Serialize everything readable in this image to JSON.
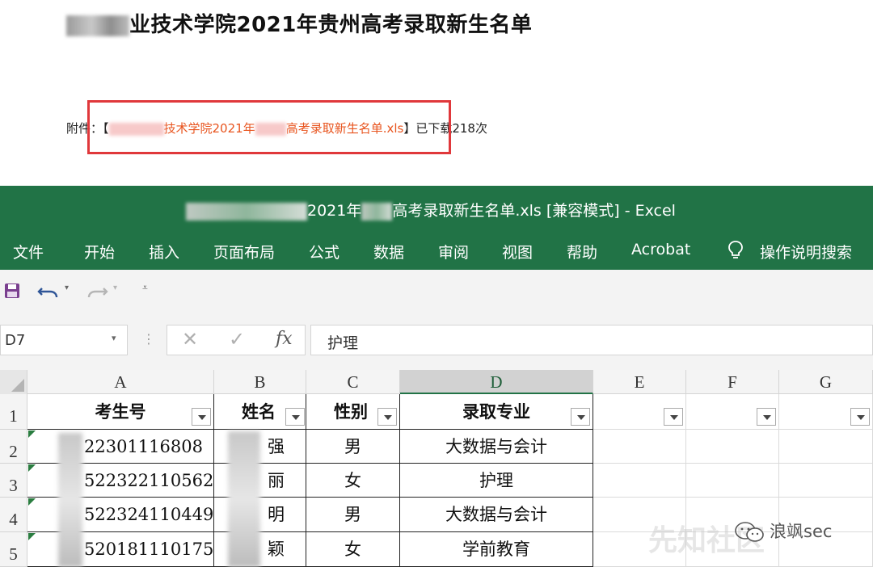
{
  "article": {
    "title": "业技术学院2021年贵州高考录取新生名单",
    "attach_prefix": "附件：【",
    "attach_link_a": "技术学院2021年",
    "attach_link_b": "高考录取新生名单.xls",
    "attach_suffix": "】已下载218次"
  },
  "excel": {
    "title_prefix": "2021年",
    "title_suffix": "高考录取新生名单.xls  [兼容模式]  -  Excel",
    "menu": [
      "文件",
      "开始",
      "插入",
      "页面布局",
      "公式",
      "数据",
      "审阅",
      "视图",
      "帮助",
      "Acrobat",
      "操作说明搜索"
    ],
    "name_box": "D7",
    "formula_value": "护理",
    "fx_label": "fx",
    "columns": [
      "A",
      "B",
      "C",
      "D",
      "E",
      "F",
      "G"
    ],
    "rows": [
      "1",
      "2",
      "3",
      "4",
      "5"
    ],
    "headers": [
      "考生号",
      "姓名",
      "性别",
      "录取专业"
    ],
    "records": [
      {
        "id": "22301116808",
        "name": "强",
        "gender": "男",
        "major": "大数据与会计"
      },
      {
        "id": "522322110562",
        "name": "丽",
        "gender": "女",
        "major": "护理"
      },
      {
        "id": "522324110449",
        "name": "明",
        "gender": "男",
        "major": "大数据与会计"
      },
      {
        "id": "520181110175",
        "name": "颖",
        "gender": "女",
        "major": "学前教育"
      }
    ]
  },
  "watermark": {
    "text": "先知社区",
    "badge": "浪飒sec"
  },
  "colors": {
    "excel_green": "#217346",
    "link_orange": "#e8541e",
    "highlight_red": "#e0383b"
  }
}
